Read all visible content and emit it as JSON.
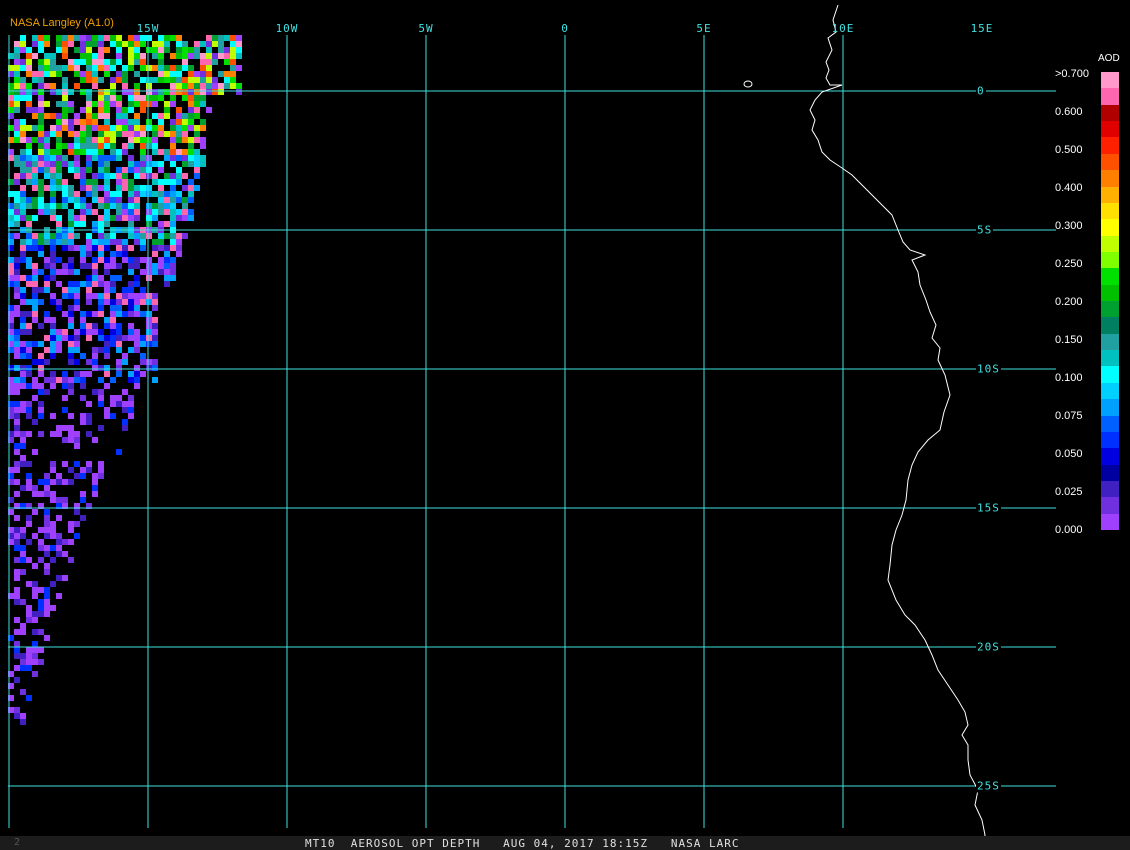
{
  "credit": "NASA Langley (A1.0)",
  "grid": {
    "lon_labels": [
      {
        "text": "15W",
        "deg": -15
      },
      {
        "text": "10W",
        "deg": -10
      },
      {
        "text": "5W",
        "deg": -5
      },
      {
        "text": "0",
        "deg": 0
      },
      {
        "text": "5E",
        "deg": 5
      },
      {
        "text": "10E",
        "deg": 10
      },
      {
        "text": "15E",
        "deg": 15
      }
    ],
    "lat_labels": [
      {
        "text": "0",
        "deg": 0
      },
      {
        "text": "5S",
        "deg": -5
      },
      {
        "text": "10S",
        "deg": -10
      },
      {
        "text": "15S",
        "deg": -15
      },
      {
        "text": "20S",
        "deg": -20
      },
      {
        "text": "25S",
        "deg": -25
      }
    ]
  },
  "legend": {
    "title": "AOD",
    "labels": [
      ">0.700",
      "0.600",
      "0.500",
      "0.400",
      "0.300",
      "0.250",
      "0.200",
      "0.150",
      "0.100",
      "0.075",
      "0.050",
      "0.025",
      "0.000"
    ],
    "colors": [
      "#ff99cc",
      "#ff66b0",
      "#b00000",
      "#e00000",
      "#ff2000",
      "#ff5000",
      "#ff8000",
      "#ffb000",
      "#ffe000",
      "#ffff00",
      "#c0ff00",
      "#80ff00",
      "#00e000",
      "#00c000",
      "#00a030",
      "#008060",
      "#20a0a0",
      "#00c0c0",
      "#00ffff",
      "#00d0ff",
      "#00a0ff",
      "#0060ff",
      "#0030ff",
      "#0000e0",
      "#0000a0",
      "#4020c0",
      "#7030e0",
      "#a040ff"
    ]
  },
  "footer": {
    "text": "MT10  AEROSOL OPT DEPTH   AUG 04, 2017 18:15Z   NASA LARC",
    "frame_number": "2"
  },
  "colors": {
    "grid": "#40e0e0",
    "coastline": "#ffffff",
    "credit": "#f0a000"
  }
}
